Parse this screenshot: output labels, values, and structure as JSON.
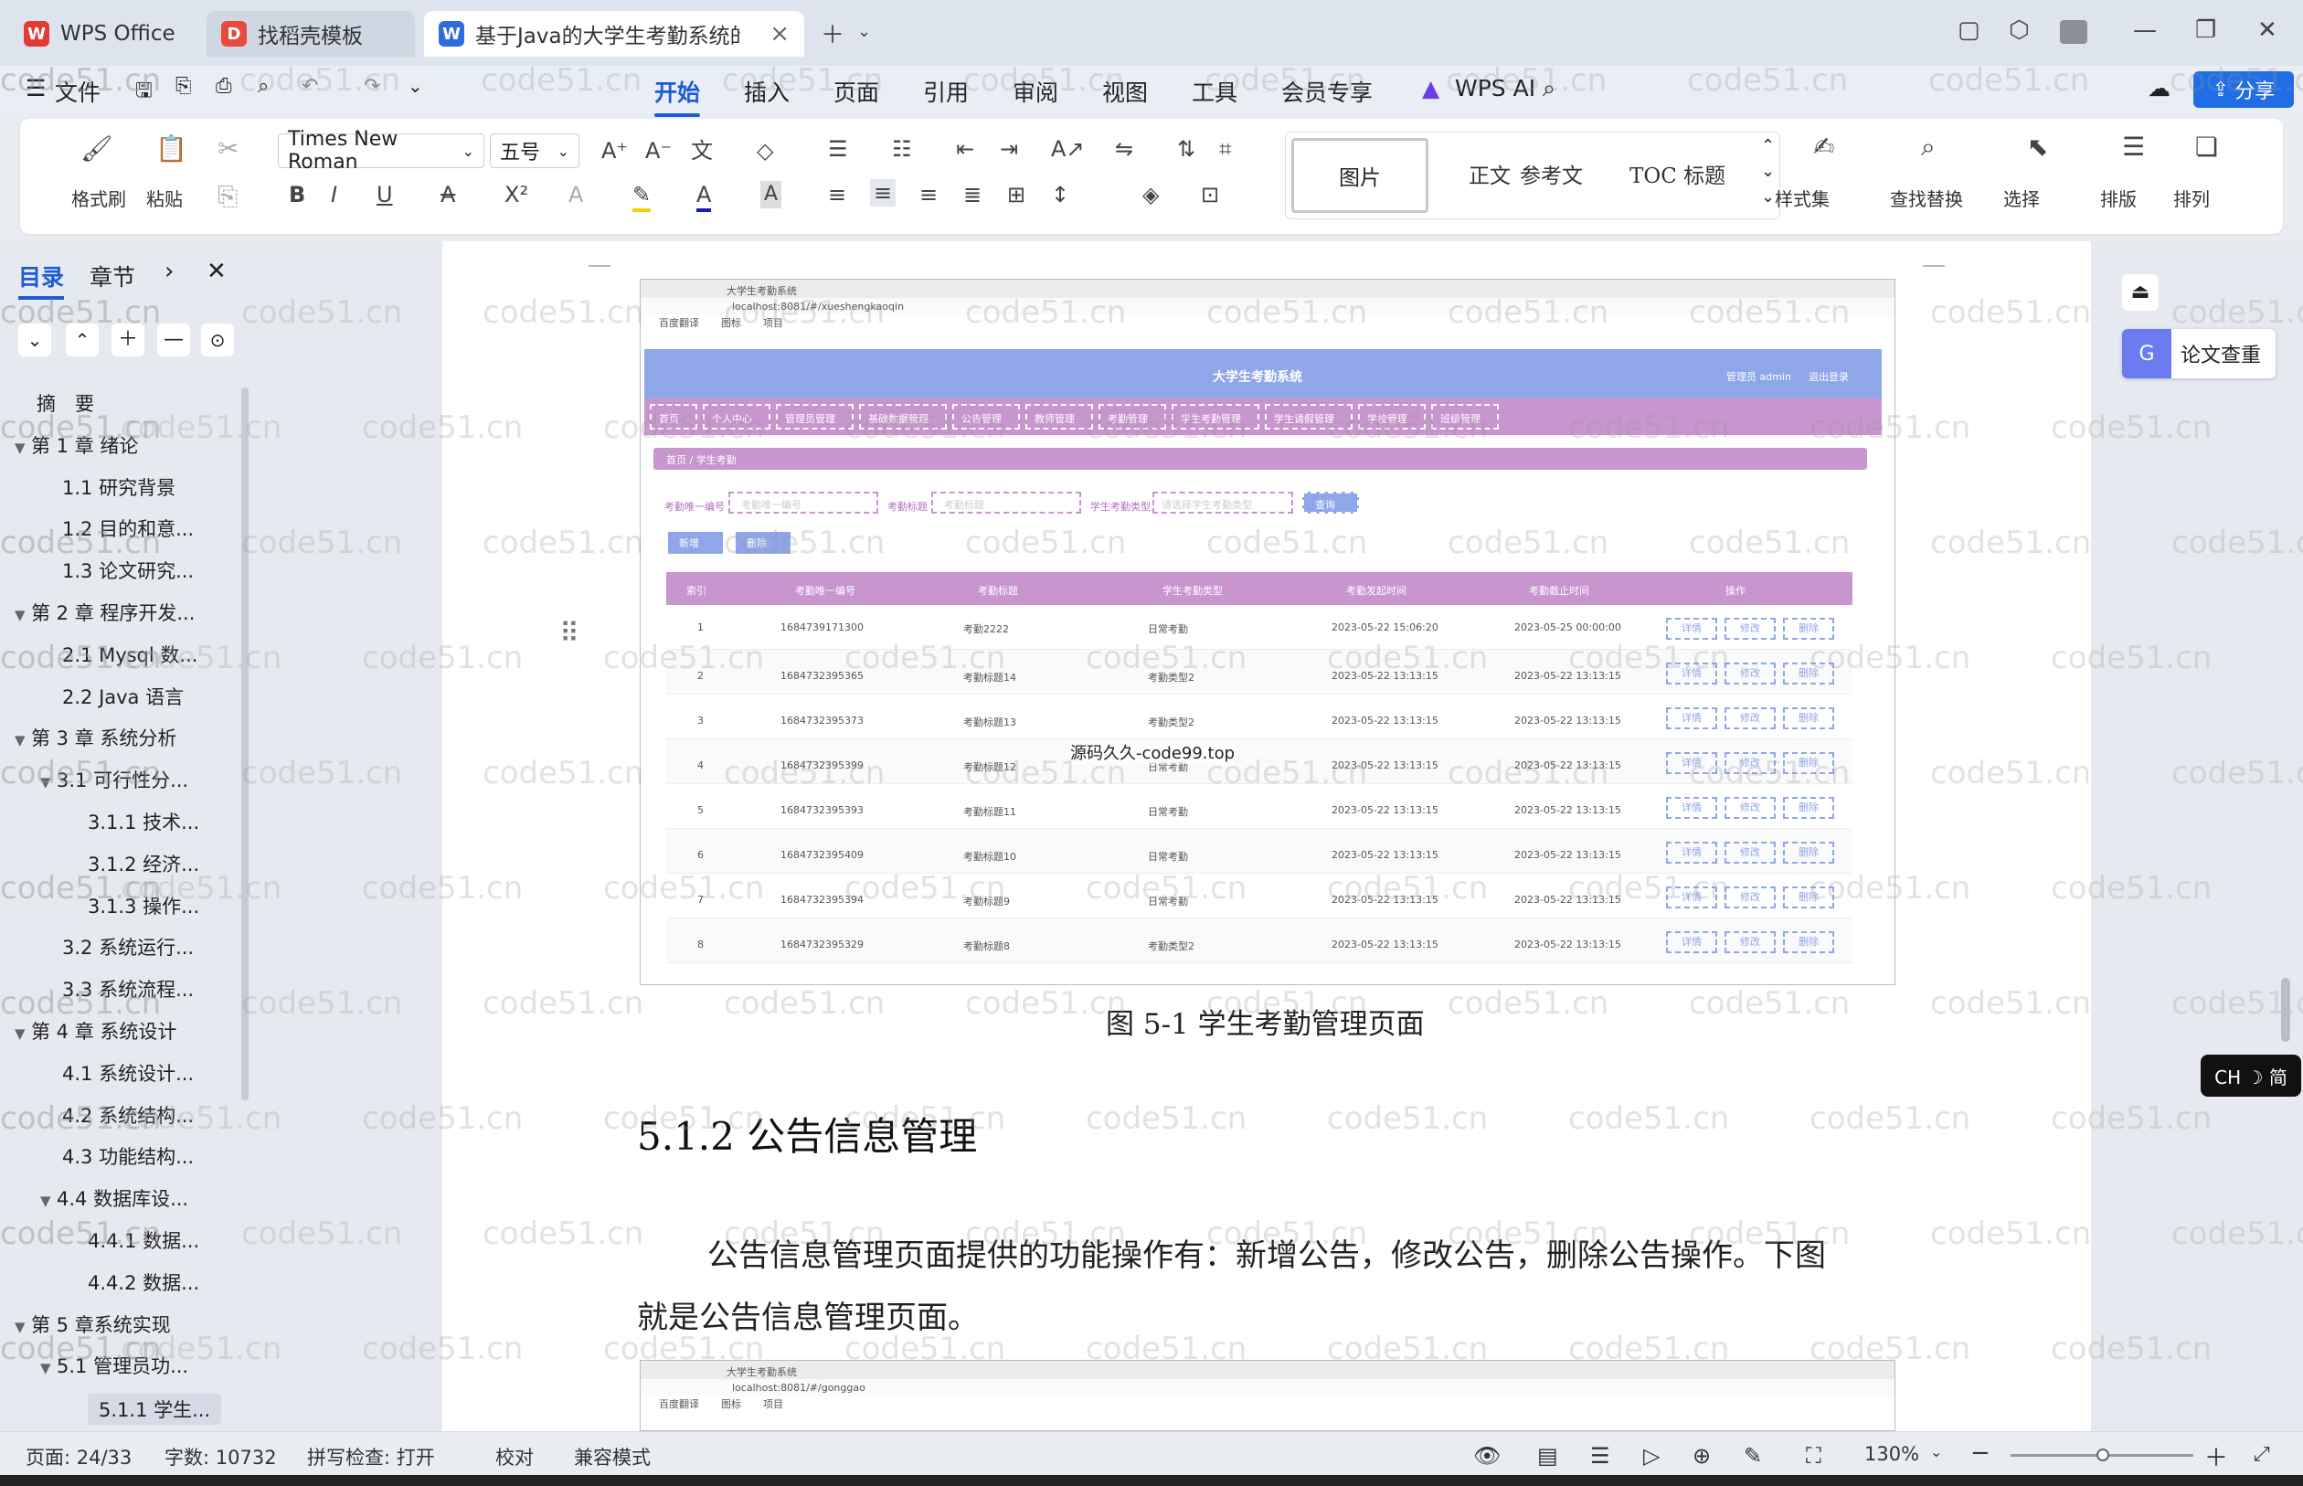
{
  "tabs": [
    {
      "label": "WPS Office"
    },
    {
      "label": "找稻壳模板"
    },
    {
      "label": "基于Java的大学生考勤系统的设"
    }
  ],
  "menu": {
    "file": "文件",
    "tabs": [
      "开始",
      "插入",
      "页面",
      "引用",
      "审阅",
      "视图",
      "工具",
      "会员专享"
    ],
    "wps_ai": "WPS AI"
  },
  "ribbon": {
    "format_painter": "格式刷",
    "paste": "粘贴",
    "font_name": "Times New Roman",
    "font_size": "五号",
    "styles": [
      "图片",
      "正文",
      "参考文",
      "TOC 标题"
    ],
    "style_set": "样式集",
    "find_replace": "查找替换",
    "select": "选择",
    "typeset": "排版",
    "arrange": "排列"
  },
  "share": "分享",
  "left": {
    "tab_toc": "目录",
    "tab_chapter": "章节",
    "items": [
      {
        "text": "摘　要",
        "level": 0,
        "arrow": ""
      },
      {
        "text": "第 1 章  绪论",
        "level": 0,
        "arrow": "▼"
      },
      {
        "text": "1.1  研究背景",
        "level": 1,
        "arrow": ""
      },
      {
        "text": "1.2 目的和意...",
        "level": 1,
        "arrow": ""
      },
      {
        "text": "1.3  论文研究...",
        "level": 1,
        "arrow": ""
      },
      {
        "text": "第 2 章  程序开发...",
        "level": 0,
        "arrow": "▼"
      },
      {
        "text": "2.1 Mysql 数...",
        "level": 1,
        "arrow": ""
      },
      {
        "text": "2.2 Java 语言",
        "level": 1,
        "arrow": ""
      },
      {
        "text": "第 3 章  系统分析",
        "level": 0,
        "arrow": "▼"
      },
      {
        "text": "3.1  可行性分...",
        "level": 1,
        "arrow": "▼"
      },
      {
        "text": "3.1.1  技术...",
        "level": 2,
        "arrow": ""
      },
      {
        "text": "3.1.2  经济...",
        "level": 2,
        "arrow": ""
      },
      {
        "text": "3.1.3  操作...",
        "level": 2,
        "arrow": ""
      },
      {
        "text": "3.2  系统运行...",
        "level": 1,
        "arrow": ""
      },
      {
        "text": "3.3  系统流程...",
        "level": 1,
        "arrow": ""
      },
      {
        "text": "第 4 章  系统设计",
        "level": 0,
        "arrow": "▼"
      },
      {
        "text": "4.1  系统设计...",
        "level": 1,
        "arrow": ""
      },
      {
        "text": "4.2  系统结构...",
        "level": 1,
        "arrow": ""
      },
      {
        "text": "4.3 功能结构...",
        "level": 1,
        "arrow": ""
      },
      {
        "text": "4.4  数据库设...",
        "level": 1,
        "arrow": "▼"
      },
      {
        "text": "4.4.1  数据...",
        "level": 2,
        "arrow": ""
      },
      {
        "text": "4.4.2  数据...",
        "level": 2,
        "arrow": ""
      },
      {
        "text": "第 5 章系统实现",
        "level": 0,
        "arrow": "▼"
      },
      {
        "text": "5.1  管理员功...",
        "level": 1,
        "arrow": "▼"
      },
      {
        "text": "5.1.1  学生...",
        "level": 2,
        "arrow": "",
        "active": true
      }
    ]
  },
  "doc": {
    "caption": "图 5-1  学生考勤管理页面",
    "heading": "5.1.2  公告信息管理",
    "para1": "公告信息管理页面提供的功能操作有：新增公告，修改公告，删除公告操作。下图",
    "para2": "就是公告信息管理页面。",
    "overlay": "源码久久-code99.top",
    "watermark": "code51.cn"
  },
  "shot": {
    "tab": "大学生考勤系统",
    "url": "localhost:8081/#/xueshengkaoqin",
    "bookmarks": [
      "百度翻译",
      "图标",
      "项目"
    ],
    "title": "大学生考勤系统",
    "user": "管理员 admin",
    "logout": "退出登录",
    "nav": [
      "首页",
      "个人中心",
      "管理员管理",
      "基础数据管理",
      "公告管理",
      "教师管理",
      "考勤管理",
      "学生考勤管理",
      "学生请假管理",
      "学校管理",
      "班级管理"
    ],
    "breadcrumb": "首页 / 学生考勤",
    "search_labels": [
      "考勤唯一编号",
      "考勤标题",
      "学生考勤类型"
    ],
    "search_placeholders": [
      "考勤唯一编号",
      "考勤标题",
      "请选择学生考勤类型"
    ],
    "search_btn": "查询",
    "add_btn": "新增",
    "del_btn": "删除",
    "headers": [
      "",
      "索引",
      "考勤唯一编号",
      "考勤标题",
      "学生考勤类型",
      "考勤发起时间",
      "考勤截止时间",
      "操作"
    ],
    "actions": [
      "详情",
      "修改",
      "删除"
    ],
    "rows": [
      [
        "1",
        "1684739171300",
        "考勤2222",
        "日常考勤",
        "2023-05-22 15:06:20",
        "2023-05-25 00:00:00"
      ],
      [
        "2",
        "1684732395365",
        "考勤标题14",
        "考勤类型2",
        "2023-05-22 13:13:15",
        "2023-05-22 13:13:15"
      ],
      [
        "3",
        "1684732395373",
        "考勤标题13",
        "考勤类型2",
        "2023-05-22 13:13:15",
        "2023-05-22 13:13:15"
      ],
      [
        "4",
        "1684732395399",
        "考勤标题12",
        "日常考勤",
        "2023-05-22 13:13:15",
        "2023-05-22 13:13:15"
      ],
      [
        "5",
        "1684732395393",
        "考勤标题11",
        "日常考勤",
        "2023-05-22 13:13:15",
        "2023-05-22 13:13:15"
      ],
      [
        "6",
        "1684732395409",
        "考勤标题10",
        "日常考勤",
        "2023-05-22 13:13:15",
        "2023-05-22 13:13:15"
      ],
      [
        "7",
        "1684732395394",
        "考勤标题9",
        "日常考勤",
        "2023-05-22 13:13:15",
        "2023-05-22 13:13:15"
      ],
      [
        "8",
        "1684732395329",
        "考勤标题8",
        "考勤类型2",
        "2023-05-22 13:13:15",
        "2023-05-22 13:13:15"
      ]
    ],
    "url2": "localhost:8081/#/gonggao"
  },
  "right": {
    "paper_check": "论文查重",
    "ime": "CH ☽ 简"
  },
  "status": {
    "page": "页面: 24/33",
    "words": "字数: 10732",
    "spell": "拼写检查: 打开",
    "proof": "校对",
    "compat": "兼容模式",
    "zoom": "130%"
  },
  "colors": {
    "accent": "#1f5ad6",
    "nav_purple": "#c895cf",
    "header_blue": "#8fa6e8"
  }
}
